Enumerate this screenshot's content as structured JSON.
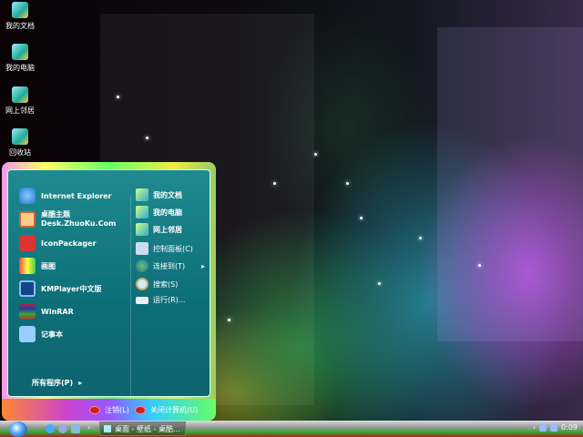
{
  "desktop_icons": [
    {
      "label": "我的文档"
    },
    {
      "label": "我的电脑"
    },
    {
      "label": "网上邻居"
    },
    {
      "label": "回收站"
    }
  ],
  "start_menu": {
    "left_items": [
      {
        "label": "Internet Explorer",
        "icon": "ie-icon"
      },
      {
        "label": "桌酷主题",
        "sub": "Desk.ZhuoKu.Com",
        "icon": "theme-icon"
      },
      {
        "label": "IconPackager",
        "icon": "iconpackager-icon"
      },
      {
        "label": "画图",
        "icon": "paint-icon"
      },
      {
        "label": "KMPlayer中文版",
        "icon": "kmplayer-icon"
      },
      {
        "label": "WinRAR",
        "icon": "winrar-icon"
      },
      {
        "label": "记事本",
        "icon": "notepad-icon"
      }
    ],
    "all_programs": "所有程序(P)",
    "right_items": [
      {
        "label": "我的文档",
        "bold": true
      },
      {
        "label": "我的电脑",
        "bold": true
      },
      {
        "label": "网上邻居",
        "bold": true
      },
      {
        "label": "控制面板(C)"
      },
      {
        "label": "连接到(T)"
      },
      {
        "label": "搜索(S)"
      },
      {
        "label": "运行(R)..."
      }
    ],
    "logoff": "注销(L)",
    "shutdown": "关闭计算机(U)"
  },
  "taskbar": {
    "task_label": "桌面 - 壁纸 - 桌酷...",
    "clock": "0:09"
  }
}
